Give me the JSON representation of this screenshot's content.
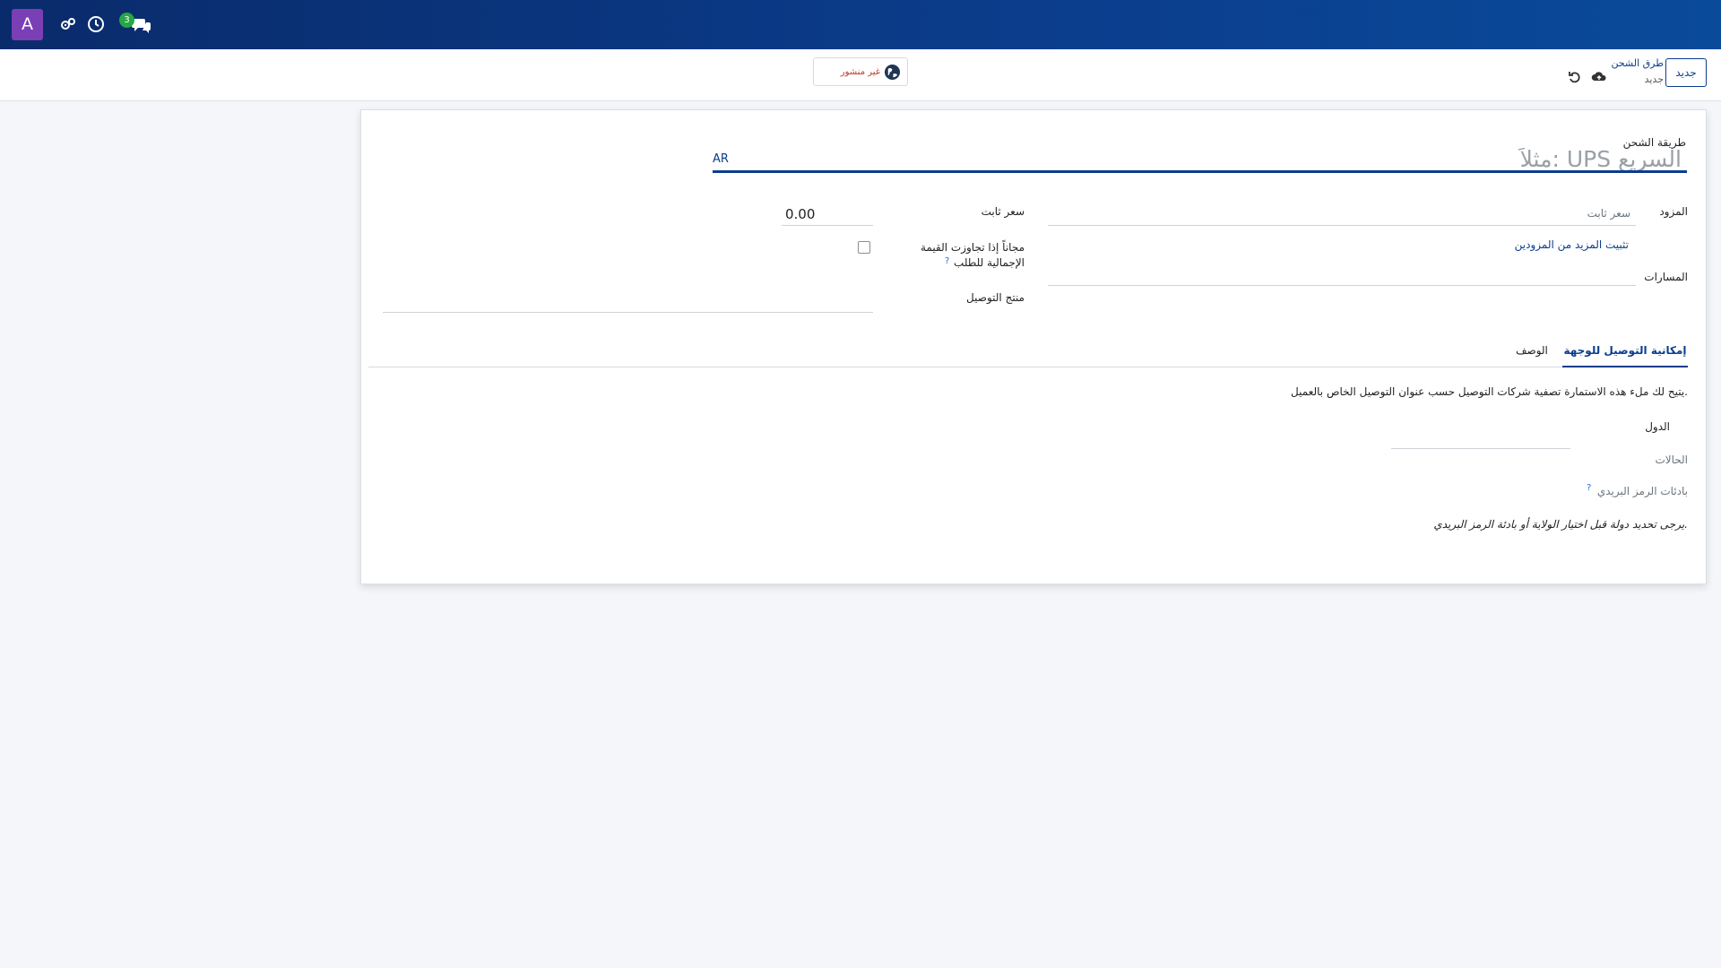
{
  "navbar": {
    "avatar_letter": "A",
    "badge_count": "3",
    "icons": [
      "gear-cluster-icon",
      "clock-icon",
      "chat-icon"
    ]
  },
  "control_panel": {
    "new_button": "جديد",
    "breadcrumb_parent": "طرق الشحن",
    "breadcrumb_current": "جديد",
    "publish_status": "غير منشور"
  },
  "form": {
    "name_label": "طريقة الشحن",
    "name_placeholder": "مثلاً: UPS السريع",
    "lang_tag": "AR",
    "provider_label": "المزود",
    "provider_value": "سعر ثابت",
    "install_more_link": "تثبيت المزيد من المزودين",
    "routes_label": "المسارات",
    "fixed_price_label": "سعر ثابت",
    "fixed_price_value": "0.00",
    "free_if_above_label_line1": "مجاناً إذا تجاوزت القيمة",
    "free_if_above_label_line2": "الإجمالية للطلب",
    "help_mark": "?",
    "delivery_product_label": "منتج التوصيل"
  },
  "tabs": {
    "availability": "إمكانية التوصيل للوجهة",
    "description": "الوصف"
  },
  "tab_content": {
    "intro": "يتيح لك ملء هذه الاستمارة تصفية شركات التوصيل حسب عنوان التوصيل الخاص بالعميل.",
    "countries_label": "الدول",
    "states_label": "الحالات",
    "zip_prefixes_label": "بادئات الرمز البريدي",
    "zip_help": "?",
    "warning": "يرجى تحديد دولة قبل اختيار الولاية أو بادئة الرمز البريدي."
  },
  "colors": {
    "navbar": "#0b3d8c",
    "accent": "#0b3d8c",
    "avatar": "#7a3fb5",
    "badge": "#28a745",
    "unpublished": "#c0392b"
  }
}
